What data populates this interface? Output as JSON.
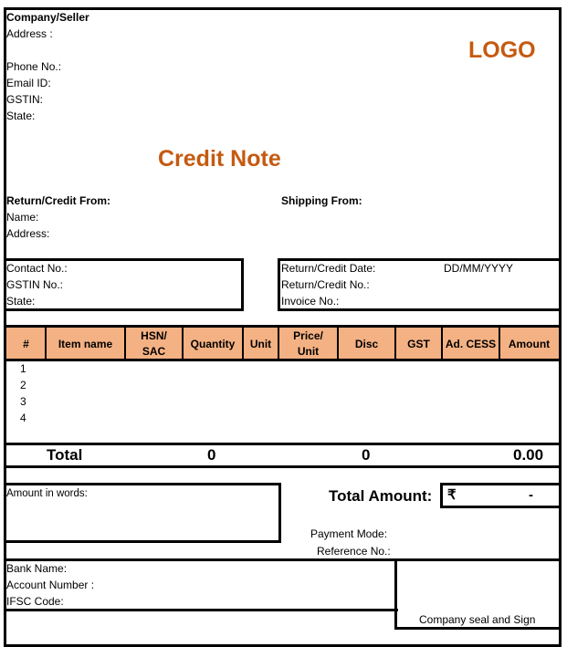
{
  "document": {
    "title": "Credit Note",
    "logo_text": "LOGO",
    "accent_color": "#c55a11",
    "header_fill_color": "#f4b183"
  },
  "seller": {
    "heading": "Company/Seller",
    "address_label": "Address :",
    "phone_label": "Phone No.:",
    "email_label": "Email ID:",
    "gstin_label": "GSTIN:",
    "state_label": "State:"
  },
  "return_from": {
    "heading": "Return/Credit From:",
    "name_label": "Name:",
    "address_label": "Address:",
    "contact_label": "Contact No.:",
    "gstin_label": "GSTIN No.:",
    "state_label": "State:"
  },
  "shipping": {
    "heading": "Shipping From:"
  },
  "credit_info": {
    "date_label": "Return/Credit Date:",
    "date_value": "DD/MM/YYYY",
    "number_label": "Return/Credit No.:",
    "invoice_label": "Invoice No.:"
  },
  "table": {
    "columns": [
      {
        "line1": "#",
        "line2": ""
      },
      {
        "line1": "Item name",
        "line2": ""
      },
      {
        "line1": "HSN/",
        "line2": "SAC"
      },
      {
        "line1": "Quantity",
        "line2": ""
      },
      {
        "line1": "Unit",
        "line2": ""
      },
      {
        "line1": "Price/",
        "line2": "Unit"
      },
      {
        "line1": "Disc",
        "line2": ""
      },
      {
        "line1": "GST",
        "line2": ""
      },
      {
        "line1": "Ad. CESS",
        "line2": ""
      },
      {
        "line1": "Amount",
        "line2": ""
      }
    ],
    "rows": [
      {
        "num": "1"
      },
      {
        "num": "2"
      },
      {
        "num": "3"
      },
      {
        "num": "4"
      }
    ],
    "totals": {
      "label": "Total",
      "quantity": "0",
      "disc": "0",
      "amount": "0.00"
    }
  },
  "summary": {
    "amount_in_words_label": "Amount in words:",
    "total_amount_label": "Total Amount:",
    "currency_symbol": "₹",
    "total_amount_value": "-",
    "payment_mode_label": "Payment Mode:",
    "reference_label": "Reference No.:"
  },
  "bank": {
    "bank_name_label": "Bank Name:",
    "account_label": "Account Number :",
    "ifsc_label": "IFSC Code:"
  },
  "signature": {
    "label": "Company seal and Sign"
  }
}
